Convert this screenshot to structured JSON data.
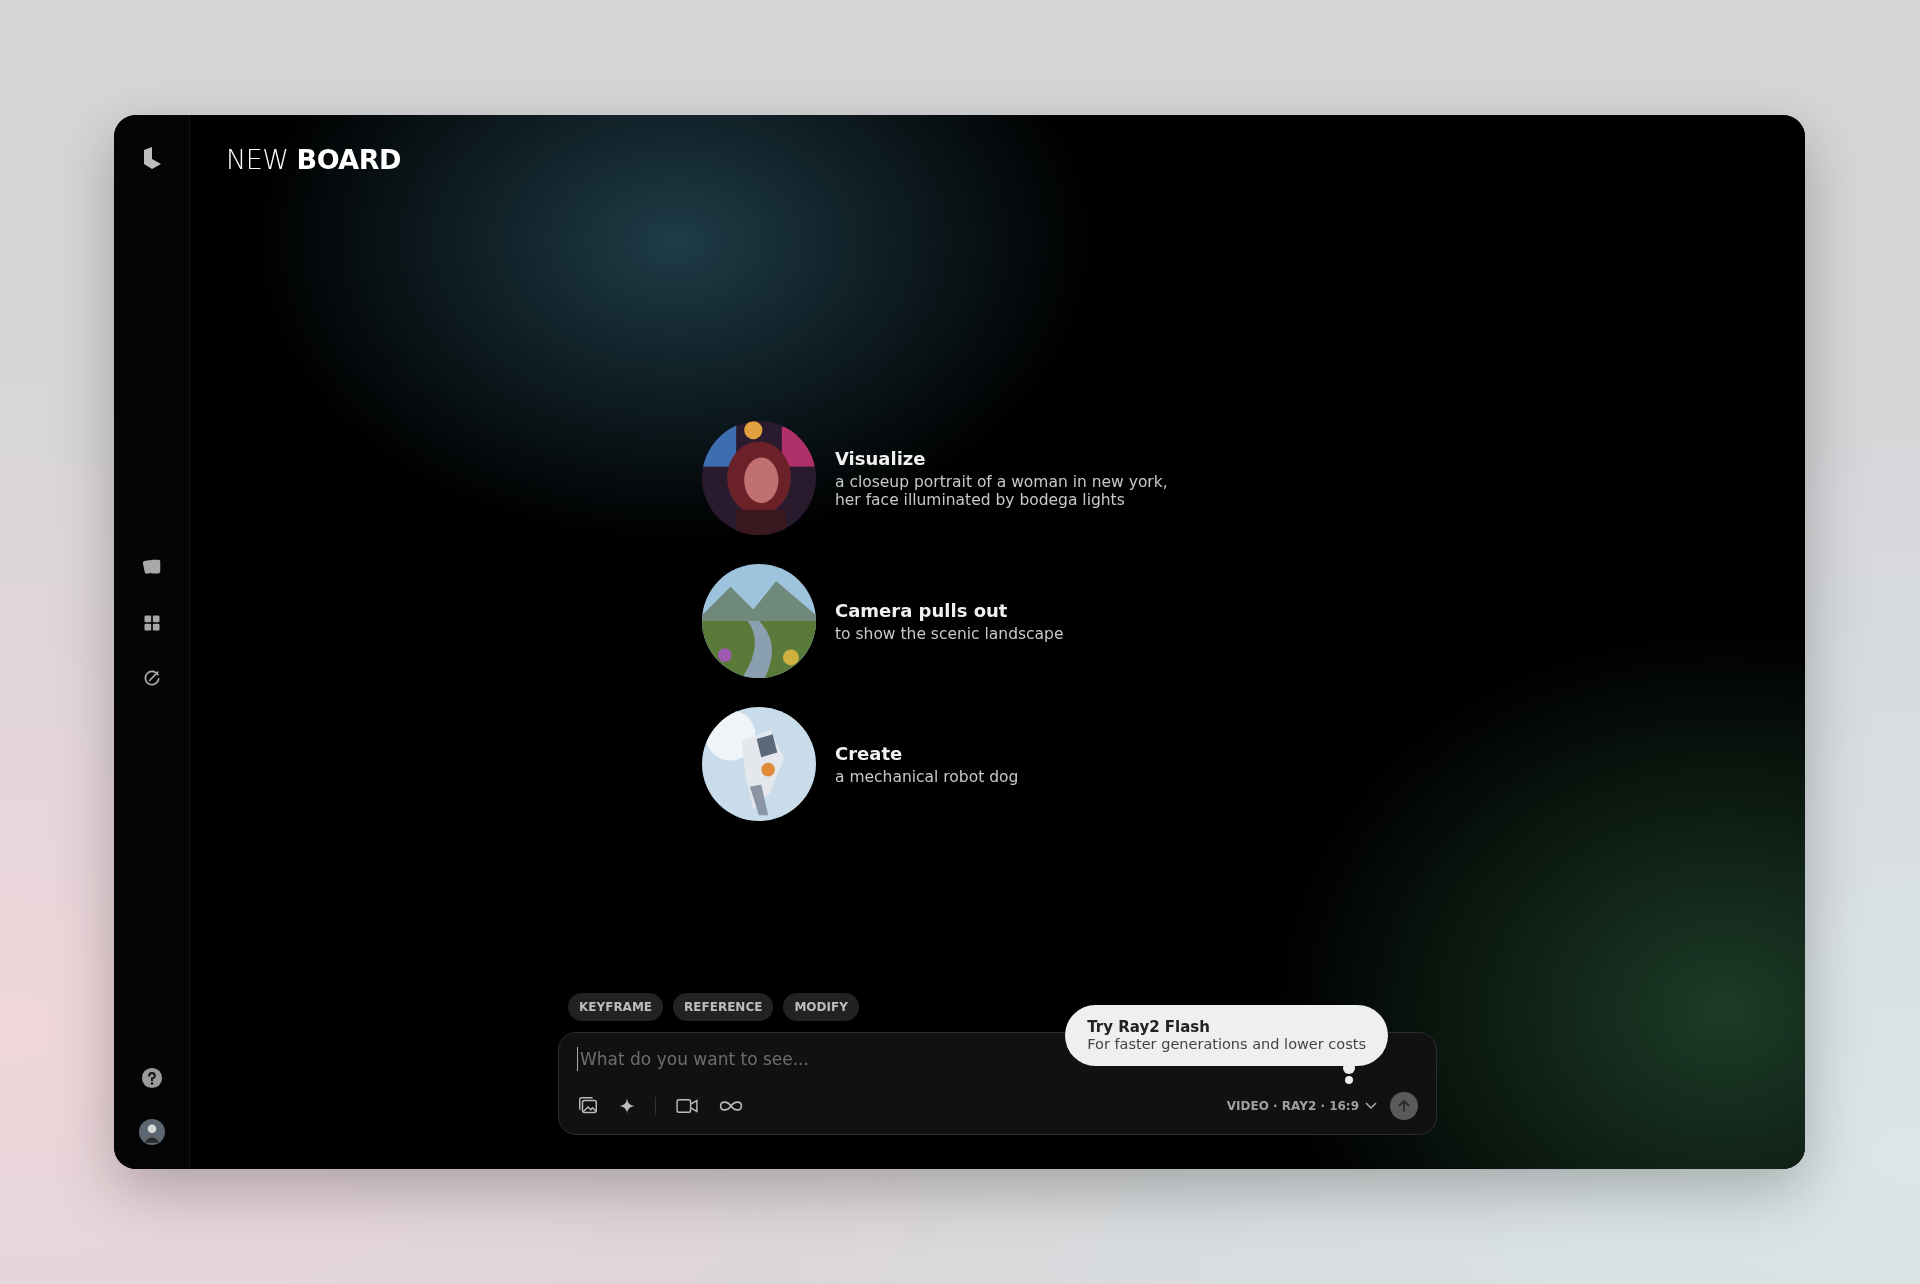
{
  "board_title": {
    "light": "NEW",
    "bold": "BOARD"
  },
  "suggestions": [
    {
      "kind": "picture",
      "title": "Visualize",
      "description": "a closeup portrait of a woman in new york, her face illuminated by bodega lights"
    },
    {
      "kind": "picture",
      "title": "Camera pulls out",
      "description": "to show the scenic landscape"
    },
    {
      "kind": "picture",
      "title": "Create",
      "description": "a mechanical robot dog"
    }
  ],
  "chips": [
    "KEYFRAME",
    "REFERENCE",
    "MODIFY"
  ],
  "prompt": {
    "placeholder": "What do you want to see..."
  },
  "tooltip": {
    "title": "Try Ray2 Flash",
    "text": "For faster generations and lower costs"
  },
  "model_selector": "VIDEO · RAY2 · 16:9"
}
